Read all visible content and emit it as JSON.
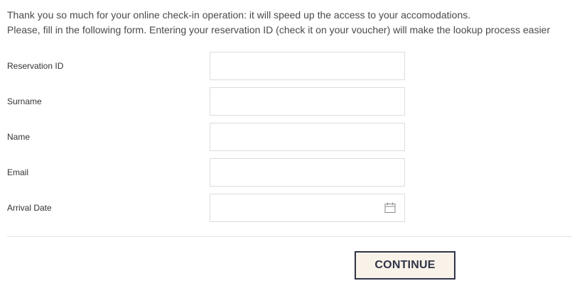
{
  "intro": {
    "line1": "Thank you so much for your online check-in operation: it will speed up the access to your accomodations.",
    "line2": "Please, fill in the following form. Entering your reservation ID (check it on your voucher) will make the lookup process easier"
  },
  "form": {
    "fields": [
      {
        "label": "Reservation ID",
        "value": "",
        "placeholder": ""
      },
      {
        "label": "Surname",
        "value": "",
        "placeholder": ""
      },
      {
        "label": "Name",
        "value": "",
        "placeholder": ""
      },
      {
        "label": "Email",
        "value": "",
        "placeholder": ""
      },
      {
        "label": "Arrival Date",
        "value": "",
        "placeholder": "",
        "icon": "calendar-icon"
      }
    ]
  },
  "actions": {
    "continue_label": "CONTINUE"
  },
  "colors": {
    "text": "#4a4a4a",
    "input_border": "#dcdcdc",
    "button_border": "#2f3447",
    "button_background": "#f8f2e8",
    "icon": "#8a8a8a"
  }
}
